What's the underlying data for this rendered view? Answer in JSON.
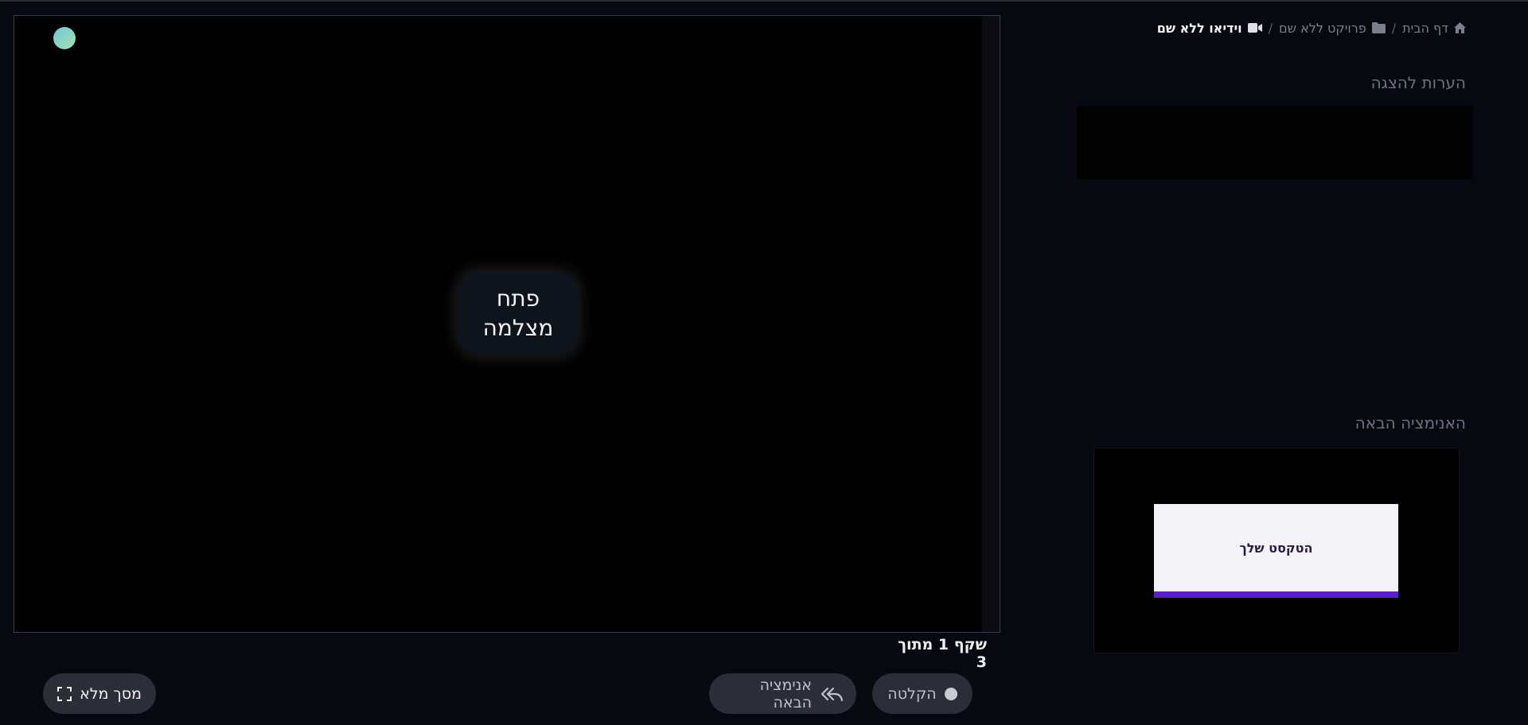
{
  "breadcrumb": {
    "home": "דף הבית",
    "project": "פרויקט ללא שם",
    "video": "וידיאו ללא שם",
    "separator": "/"
  },
  "stage": {
    "open_camera_label": "פתח מצלמה",
    "slide_counter": "שקף 1 מתוך 3"
  },
  "controls": {
    "fullscreen_label": "מסך מלא",
    "next_animation_label": "אנימציה הבאה",
    "record_label": "הקלטה"
  },
  "notes": {
    "title": "הערות להצגה"
  },
  "next_animation": {
    "title": "האנימציה הבאה",
    "preview_text": "הטקסט שלך"
  },
  "colors": {
    "background": "#080810",
    "accent": "#5b1fc7",
    "pill": "#2b2e36"
  },
  "icons": [
    "home-icon",
    "folder-icon",
    "video-camera-icon",
    "fullscreen-icon",
    "reply-all-icon",
    "record-dot-icon"
  ]
}
